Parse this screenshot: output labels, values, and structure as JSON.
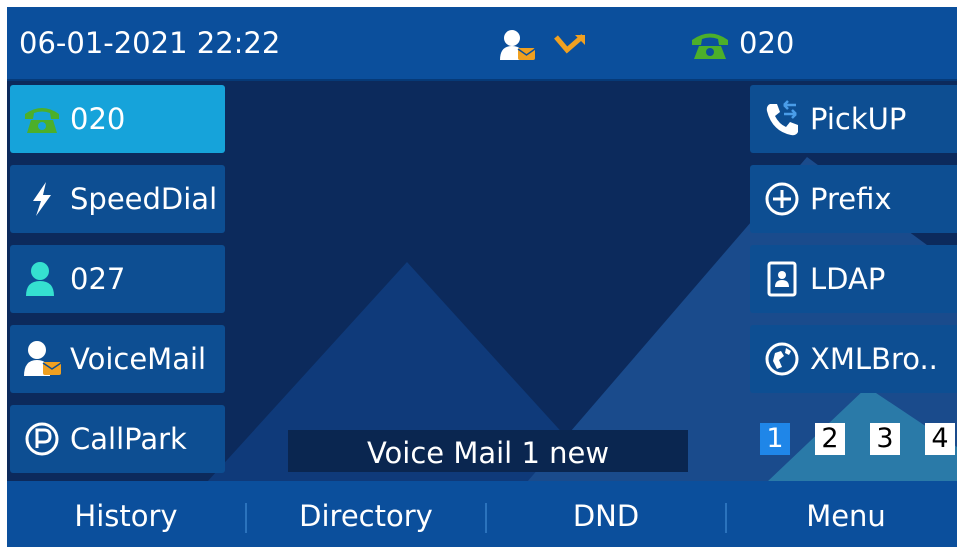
{
  "status_bar": {
    "datetime": "06-01-2021 22:22",
    "active_line": "020"
  },
  "left_keys": [
    {
      "label": "020",
      "icon": "green-phone-icon",
      "active": true
    },
    {
      "label": "SpeedDial",
      "icon": "lightning-icon",
      "active": false
    },
    {
      "label": "027",
      "icon": "contact-icon",
      "active": false
    },
    {
      "label": "VoiceMail",
      "icon": "voicemail-icon",
      "active": false
    },
    {
      "label": "CallPark",
      "icon": "park-icon",
      "active": false
    }
  ],
  "right_keys": [
    {
      "label": "PickUP",
      "icon": "pickup-phone-icon"
    },
    {
      "label": "Prefix",
      "icon": "plus-circle-icon"
    },
    {
      "label": "LDAP",
      "icon": "address-book-icon"
    },
    {
      "label": "XMLBro..",
      "icon": "globe-icon"
    }
  ],
  "notice": "Voice Mail 1 new",
  "pages": [
    "1",
    "2",
    "3",
    "4"
  ],
  "selected_page": "1",
  "softkeys": [
    "History",
    "Directory",
    "DND",
    "Menu"
  ],
  "colors": {
    "status_bar": "#0b4f9c",
    "key": "#0d4e92",
    "key_active": "#16a3da",
    "line_green": "#4caf2a",
    "voicemail_orange": "#f0a020",
    "contact_teal": "#35e0d0",
    "page_selected": "#1f86e8"
  }
}
